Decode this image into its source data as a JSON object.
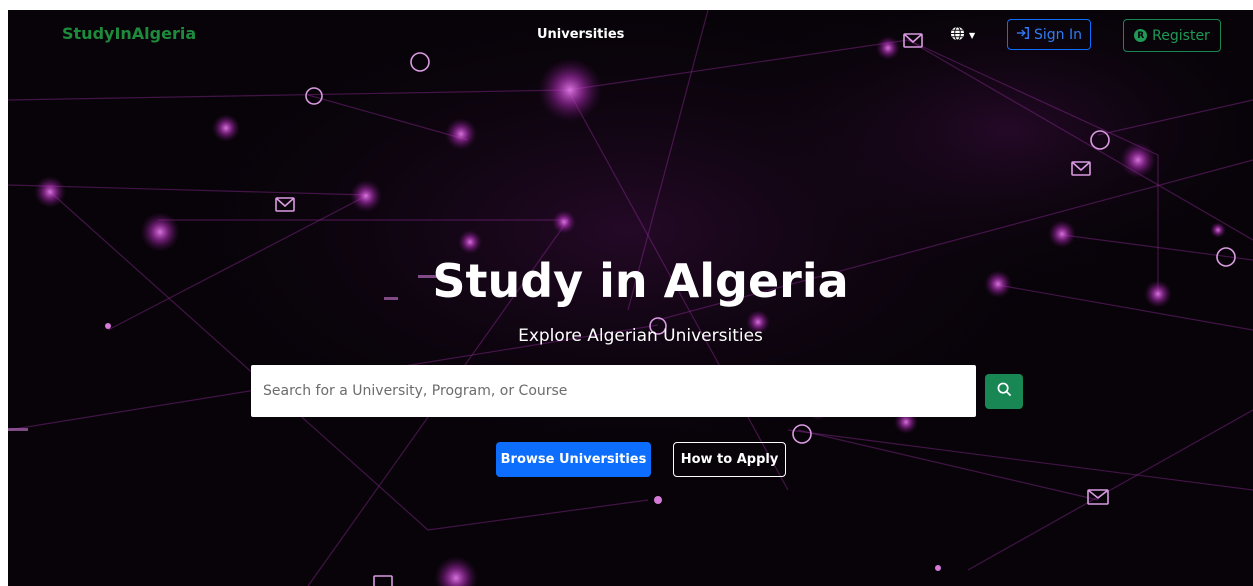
{
  "nav": {
    "brand": "StudyInAlgeria",
    "links": [
      {
        "label": "Universities"
      }
    ],
    "language_icon": "globe-icon",
    "sign_in_label": "Sign In",
    "sign_in_icon": "sign-in-arrow-icon",
    "register_label": "Register",
    "register_icon": "r-circle-icon"
  },
  "hero": {
    "title": "Study in Algeria",
    "subtitle": "Explore Algerian Universities"
  },
  "search": {
    "placeholder": "Search for a University, Program, or Course",
    "value": "",
    "button_icon": "search-icon"
  },
  "actions": {
    "browse_label": "Browse Universities",
    "how_to_apply_label": "How to Apply"
  },
  "colors": {
    "background": "#070308",
    "accent_magenta": "#c040c8",
    "brand_green": "#1e8a3c",
    "primary_blue": "#0d6efd",
    "success_green": "#198754"
  }
}
